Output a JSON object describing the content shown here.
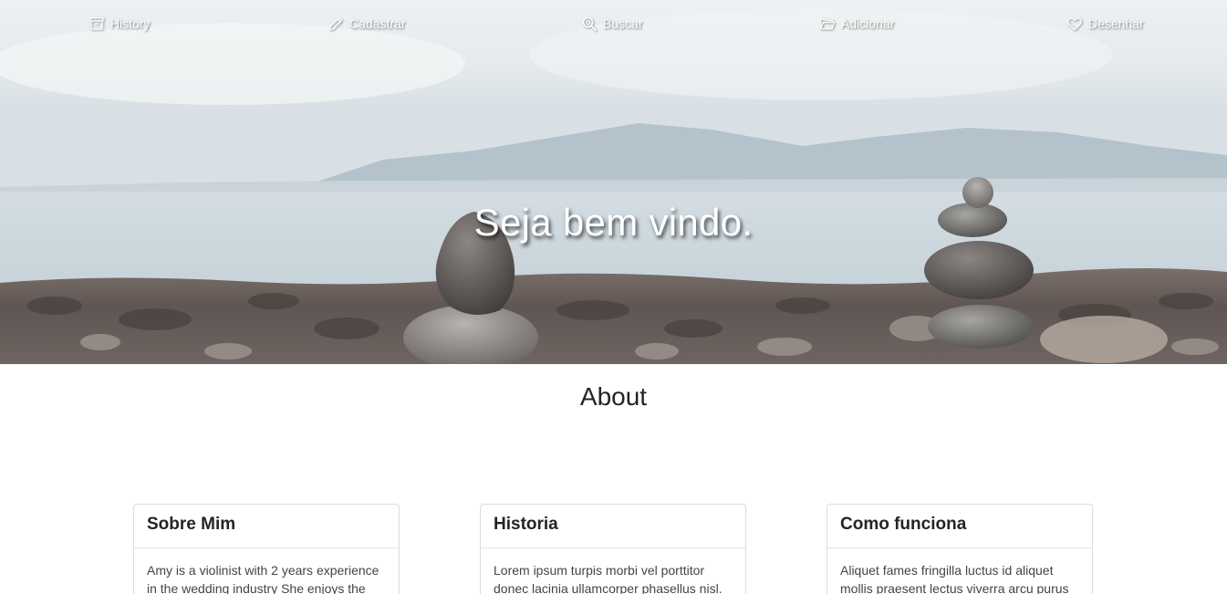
{
  "nav": {
    "items": [
      {
        "label": "History",
        "icon": "archive-icon"
      },
      {
        "label": "Cadastrar",
        "icon": "pencil-icon"
      },
      {
        "label": "Buscar",
        "icon": "search-icon"
      },
      {
        "label": "Adicionar",
        "icon": "folder-open-icon"
      },
      {
        "label": "Desenhar",
        "icon": "heart-icon"
      }
    ]
  },
  "hero": {
    "title": "Seja bem vindo."
  },
  "about": {
    "heading": "About",
    "cards": [
      {
        "title": "Sobre Mim",
        "text": "Amy is a violinist with 2 years experience in the wedding industry She enjoys the"
      },
      {
        "title": "Historia",
        "text": "Lorem ipsum turpis morbi vel porttitor donec lacinia ullamcorper phasellus nisl."
      },
      {
        "title": "Como funciona",
        "text": "Aliquet fames fringilla luctus id aliquet mollis praesent lectus viverra arcu purus"
      }
    ]
  },
  "colors": {
    "nav_text": "#ffffff",
    "heading_text": "#212529",
    "card_border": "#dcdcdc"
  }
}
